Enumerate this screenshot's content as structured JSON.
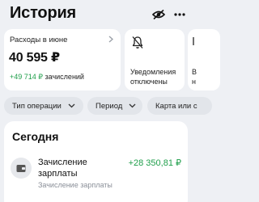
{
  "header": {
    "title": "История",
    "icons": [
      "eye-off-icon",
      "more-icon"
    ]
  },
  "cards": {
    "spending": {
      "label": "Расходы в июне",
      "amount": "40 595 ₽",
      "income_amount": "+49 714 ₽",
      "income_label": "зачислений"
    },
    "notifications": {
      "text": "Уведомления\nотключены",
      "icon": "bell-off-icon"
    },
    "peek": {
      "text": "В\nн"
    }
  },
  "filters": [
    {
      "label": "Тип операции"
    },
    {
      "label": "Период"
    },
    {
      "label": "Карта или с"
    }
  ],
  "today": {
    "title": "Сегодня",
    "transaction": {
      "title": "Зачисление\nзарплаты",
      "subtitle": "Зачисление зарплаты",
      "amount": "+28 350,81 ₽",
      "icon": "wallet-icon"
    }
  },
  "colors": {
    "background": "#eef0f4",
    "positive": "#1e9e4a",
    "chip": "#e2e5ea"
  }
}
